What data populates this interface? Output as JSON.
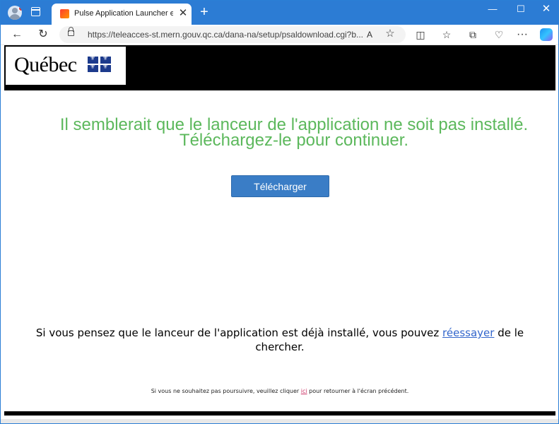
{
  "browser": {
    "tab_title": "Pulse Application Launcher est in",
    "tab_close": "✕",
    "new_tab": "+",
    "url": "https://teleacces-st.mern.gouv.qc.ca/dana-na/setup/psaldownload.cgi?b...",
    "read_aloud": "A",
    "window_controls": {
      "minimize": "—",
      "maximize": "☐",
      "close": "✕"
    },
    "icons": [
      "profile-icon",
      "tab-actions-icon",
      "back-icon",
      "refresh-icon",
      "lock-icon",
      "read-aloud-icon",
      "favorite-star-icon",
      "split-screen-icon",
      "favorites-icon",
      "collections-icon",
      "browser-essentials-icon",
      "more-icon",
      "copilot-icon"
    ]
  },
  "page": {
    "logo_text": "Québec",
    "heading_line1": "Il semblerait que le lanceur de l'application ne soit pas installé.",
    "heading_line2": "Téléchargez-le pour continuer.",
    "download_button": "Télécharger",
    "retry_before": "Si vous pensez que le lanceur de l'application est déjà installé, vous pouvez ",
    "retry_link": "réessayer",
    "retry_after": " de le chercher.",
    "footer_before": "Si vous ne souhaitez pas poursuivre, veuillez cliquer ",
    "footer_link": "ici",
    "footer_after": " pour retourner à l'écran précédent."
  },
  "colors": {
    "heading": "#5cb85c",
    "button": "#3a7dc6",
    "link": "#3366cc",
    "titlebar": "#2c7cd4"
  }
}
